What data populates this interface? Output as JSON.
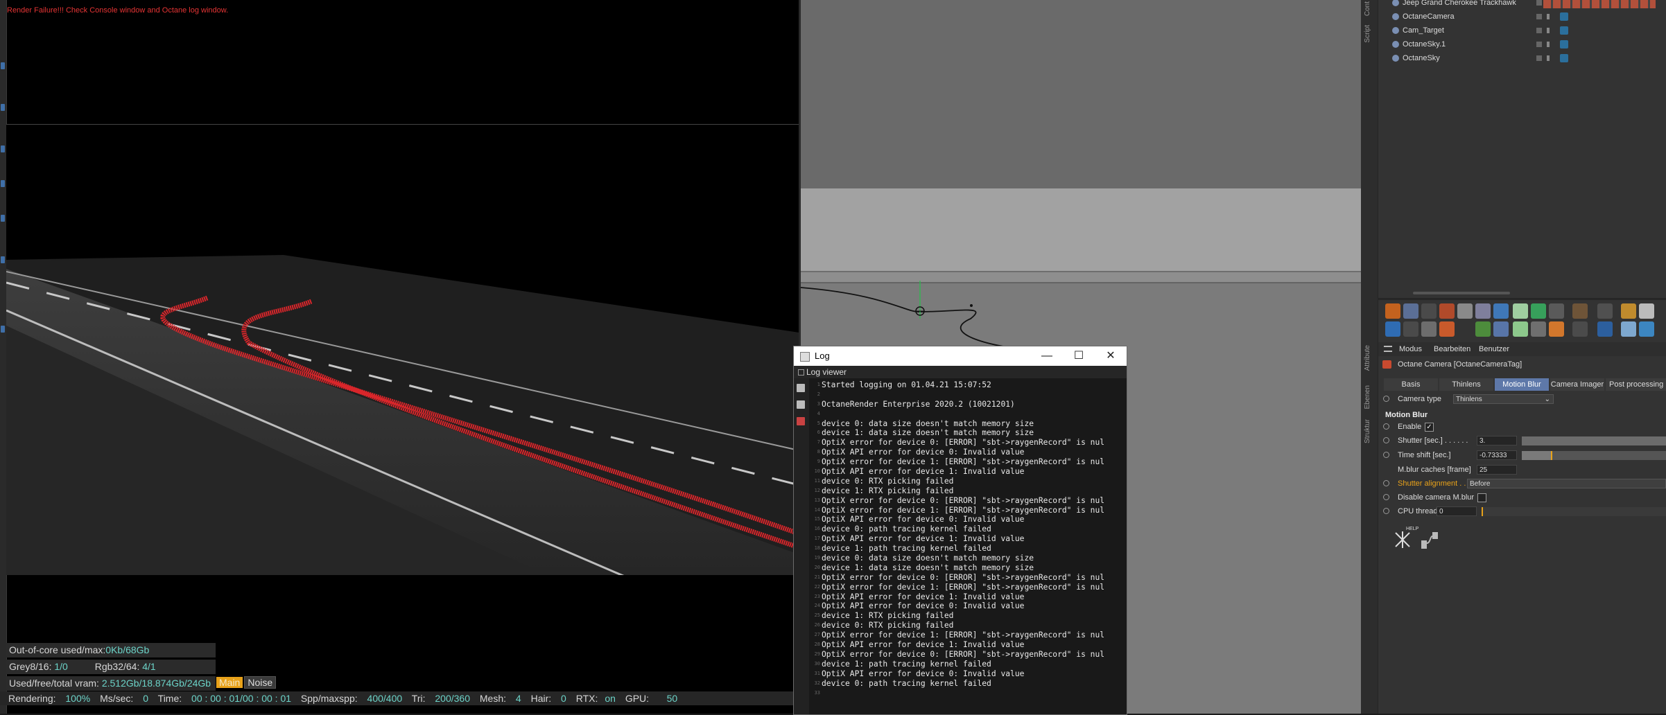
{
  "render_view": {
    "error_text": "Render Failure!!! Check Console window and Octane log window.",
    "hud": {
      "ooc_label": "Out-of-core used/max:",
      "ooc_value": "0Kb/68Gb",
      "grey_label": "Grey8/16:",
      "grey_value": "1/0",
      "rgb_label": "Rgb32/64:",
      "rgb_value": "4/1",
      "vram_label": "Used/free/total vram:",
      "vram_value": "2.512Gb/18.874Gb/24Gb",
      "main_button": "Main",
      "noise_button": "Noise"
    },
    "status": {
      "rendering_label": "Rendering:",
      "rendering_value": "100%",
      "ms_label": "Ms/sec:",
      "ms_value": "0",
      "time_label": "Time:",
      "time_value": "00 : 00 : 01/00 : 00 : 01",
      "spp_label": "Spp/maxspp:",
      "spp_value": "400/400",
      "tri_label": "Tri:",
      "tri_value": "200/360",
      "mesh_label": "Mesh:",
      "mesh_value": "4",
      "hair_label": "Hair:",
      "hair_value": "0",
      "rtx_label": "RTX:",
      "rtx_value": "on",
      "gpu_label": "GPU:",
      "gpu_value": "50"
    }
  },
  "log_window": {
    "title": "Log",
    "subtitle": "Log viewer",
    "lines": [
      "Started logging on 01.04.21 15:07:52",
      "",
      "OctaneRender Enterprise 2020.2 (10021201)",
      "",
      "device 0: data size doesn't match memory size",
      "device 1: data size doesn't match memory size",
      "OptiX error for device 0: [ERROR] \"sbt->raygenRecord\" is nul",
      "OptiX API error for device 0: Invalid value",
      "OptiX error for device 1: [ERROR] \"sbt->raygenRecord\" is nul",
      "OptiX API error for device 1: Invalid value",
      "device 0: RTX picking failed",
      "device 1: RTX picking failed",
      "OptiX error for device 0: [ERROR] \"sbt->raygenRecord\" is nul",
      "OptiX error for device 1: [ERROR] \"sbt->raygenRecord\" is nul",
      "OptiX API error for device 0: Invalid value",
      "device 0: path tracing kernel failed",
      "OptiX API error for device 1: Invalid value",
      "device 1: path tracing kernel failed",
      "device 0: data size doesn't match memory size",
      "device 1: data size doesn't match memory size",
      "OptiX error for device 0: [ERROR] \"sbt->raygenRecord\" is nul",
      "OptiX error for device 1: [ERROR] \"sbt->raygenRecord\" is nul",
      "OptiX API error for device 1: Invalid value",
      "OptiX API error for device 0: Invalid value",
      "device 1: RTX picking failed",
      "device 0: RTX picking failed",
      "OptiX error for device 1: [ERROR] \"sbt->raygenRecord\" is nul",
      "OptiX API error for device 1: Invalid value",
      "OptiX error for device 0: [ERROR] \"sbt->raygenRecord\" is nul",
      "device 1: path tracing kernel failed",
      "OptiX API error for device 0: Invalid value",
      "device 0: path tracing kernel failed",
      ""
    ]
  },
  "object_manager": {
    "objects": [
      {
        "name": "Jeep Grand Cherokee Trackhawk"
      },
      {
        "name": "OctaneCamera"
      },
      {
        "name": "Cam_Target"
      },
      {
        "name": "OctaneSky.1"
      },
      {
        "name": "OctaneSky"
      }
    ]
  },
  "attribute_manager": {
    "menu": [
      "Modus",
      "Bearbeiten",
      "Benutzer"
    ],
    "header": "Octane Camera [OctaneCameraTag]",
    "tabs": [
      "Basis",
      "Thinlens",
      "Motion Blur",
      "Camera Imager",
      "Post processing"
    ],
    "active_tab": "Motion Blur",
    "camera_type_label": "Camera type",
    "camera_type_value": "Thinlens",
    "section_title": "Motion Blur",
    "enable_label": "Enable",
    "shutter_label": "Shutter [sec.] . . . . . .",
    "shutter_value": "3.",
    "timeshift_label": "Time shift [sec.]",
    "timeshift_value": "-0.73333",
    "mblur_label": "M.blur caches [frame]",
    "mblur_value": "25",
    "shutter_align_label": "Shutter alignment . .",
    "shutter_align_value": "Before",
    "disable_mblur_label": "Disable camera M.blur",
    "cpu_threads_label": "CPU threads",
    "cpu_threads_value": "0",
    "help_label": "HELP"
  },
  "side_tabs": [
    "Cont",
    "Script",
    "Attribute",
    "Ebenen",
    "Struktur"
  ],
  "colors": {
    "error_red": "#e53434",
    "hud_value": "#6cd3c8",
    "active_tab": "#5e78a9",
    "main_button": "#e8a21a"
  }
}
